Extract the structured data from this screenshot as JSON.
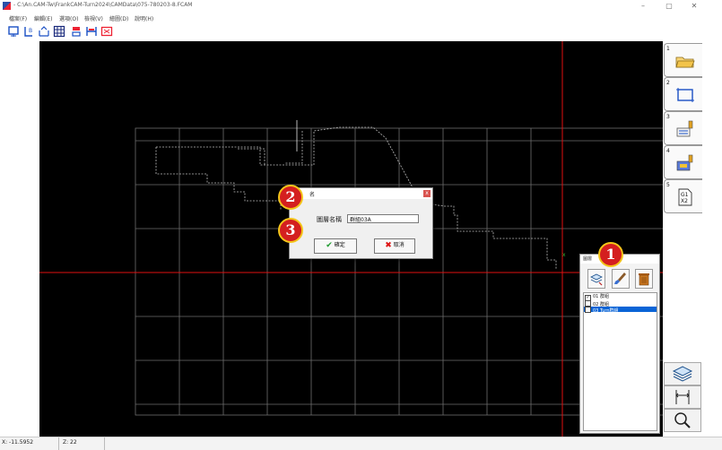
{
  "window": {
    "title": "- C:\\An.CAM-Tw\\FrankCAM-Turn2024\\CAMData\\075-780203-8.FCAM",
    "minimize_glyph": "–",
    "maximize_glyph": "▢",
    "close_glyph": "✕"
  },
  "menu": [
    "檔案(F)",
    "編輯(E)",
    "選項(O)",
    "檢視(V)",
    "繪圖(D)",
    "說明(H)"
  ],
  "toolbar_icons": [
    "select-window-icon",
    "text-icon",
    "dimension-icon",
    "grid-icon",
    "layer-stack-icon",
    "width-icon",
    "fullscreen-icon"
  ],
  "side_tabs": [
    {
      "num": "1",
      "icon": "folder-open-icon"
    },
    {
      "num": "2",
      "icon": "rectangle-select-icon"
    },
    {
      "num": "3",
      "icon": "toolpath-icon"
    },
    {
      "num": "4",
      "icon": "machine-icon"
    },
    {
      "num": "5",
      "icon": "gcode-icon",
      "text": "G1\nX2"
    }
  ],
  "side_bottom_buttons": [
    "layers-icon",
    "dimension-fit-icon",
    "zoom-icon"
  ],
  "status": {
    "x": "X: -11.5952",
    "z": "Z: 22"
  },
  "dialog": {
    "title": "名",
    "close_glyph": "x",
    "name_label": "圖層名稱",
    "name_value": "群組03A",
    "ok_label": "確定",
    "cancel_label": "取消"
  },
  "layer_panel": {
    "title": "圖層",
    "layers": [
      {
        "checked": true,
        "label": "01 群組",
        "selected": false
      },
      {
        "checked": false,
        "label": "02 群組",
        "selected": false
      },
      {
        "checked": false,
        "label": "03 Turn群組",
        "selected": true
      }
    ]
  },
  "markers": [
    "1",
    "2",
    "3"
  ],
  "colors": {
    "canvas": "#000000",
    "crosshair": "#e01010",
    "grid": "#7a7a7a",
    "marker_fill": "#d41f1f",
    "marker_ring": "#f3c51a",
    "selection": "#0a64d6"
  }
}
